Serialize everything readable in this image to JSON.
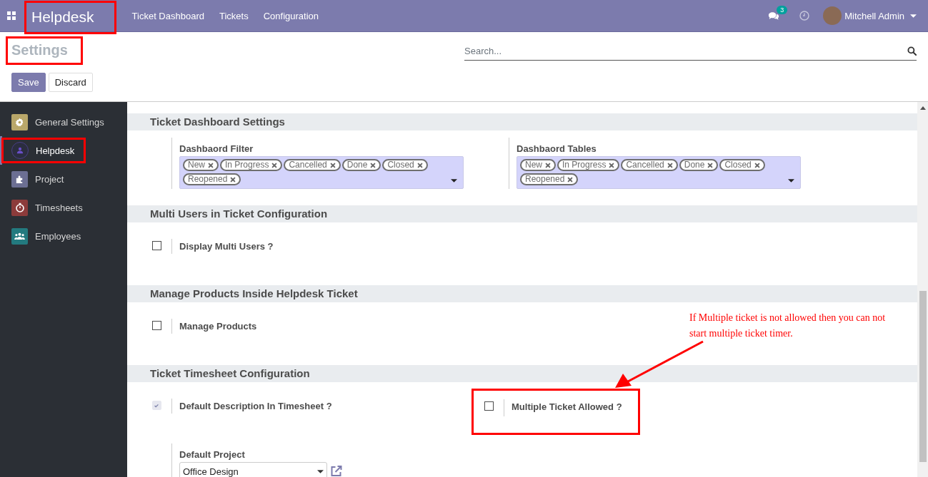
{
  "navbar": {
    "brand": {
      "text": "Helpdesk",
      "highlighted": true
    },
    "menu": [
      "Ticket Dashboard",
      "Tickets",
      "Configuration"
    ],
    "messages_badge": "3",
    "user": "Mitchell Admin"
  },
  "control_panel": {
    "title": {
      "text": "Settings",
      "highlighted": true
    },
    "search": {
      "placeholder": "Search..."
    },
    "buttons": [
      {
        "label": "Save",
        "kind": "primary"
      },
      {
        "label": "Discard",
        "kind": "secondary"
      }
    ]
  },
  "sidebar": {
    "items": [
      {
        "label": "General Settings",
        "selected": false,
        "highlighted": false,
        "color": "#b9a76a"
      },
      {
        "label": "Helpdesk",
        "selected": true,
        "highlighted": true,
        "color": "#2b2d3f"
      },
      {
        "label": "Project",
        "selected": false,
        "highlighted": false,
        "color": "#6c6f93"
      },
      {
        "label": "Timesheets",
        "selected": false,
        "highlighted": false,
        "color": "#8c3b3b"
      },
      {
        "label": "Employees",
        "selected": false,
        "highlighted": false,
        "color": "#237a7f"
      }
    ]
  },
  "sections": [
    {
      "title": "Ticket Dashboard Settings",
      "settings": [
        {
          "kind": "tags",
          "label": "Dashbaord Filter",
          "tags": [
            "New",
            "In Progress",
            "Cancelled",
            "Done",
            "Closed",
            "Reopened"
          ]
        },
        {
          "kind": "tags",
          "label": "Dashbaord Tables",
          "tags": [
            "New",
            "In Progress",
            "Cancelled",
            "Done",
            "Closed",
            "Reopened"
          ]
        }
      ]
    },
    {
      "title": "Multi Users in Ticket Configuration",
      "settings": [
        {
          "kind": "checkbox",
          "label": "Display Multi Users ?",
          "checked": false,
          "disabled": false,
          "highlighted": false
        }
      ]
    },
    {
      "title": "Manage Products Inside Helpdesk Ticket",
      "settings": [
        {
          "kind": "checkbox",
          "label": "Manage Products",
          "checked": false,
          "disabled": false,
          "highlighted": false
        }
      ]
    },
    {
      "title": "Ticket Timesheet Configuration",
      "settings": [
        {
          "kind": "checkbox",
          "label": "Default Description In Timesheet ?",
          "checked": true,
          "disabled": true,
          "highlighted": false
        },
        {
          "kind": "checkbox",
          "label": "Multiple Ticket Allowed ?",
          "checked": false,
          "disabled": false,
          "highlighted": true
        },
        {
          "kind": "select",
          "label": "Default Project",
          "value": "Office Design"
        }
      ]
    }
  ],
  "annotation": {
    "text": "If Multiple ticket is not allowed then you can not start multiple ticket timer."
  }
}
